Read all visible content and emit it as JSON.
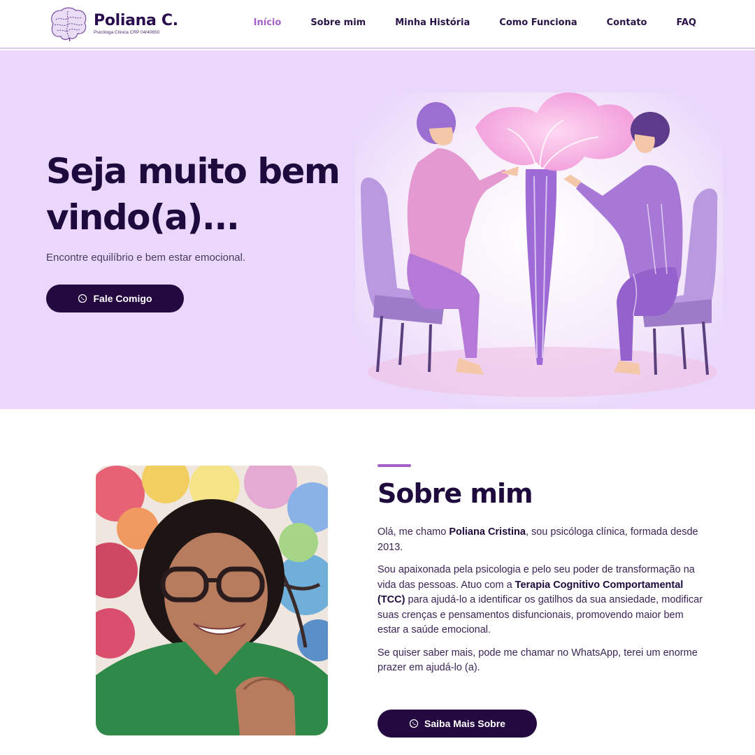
{
  "brand": {
    "name": "Poliana C.",
    "subtitle": "Psicóloga Clínica CRP 04/40650",
    "logo_icon": "brain-icon"
  },
  "nav": {
    "items": [
      {
        "label": "Início",
        "active": true
      },
      {
        "label": "Sobre mim",
        "active": false
      },
      {
        "label": "Minha História",
        "active": false
      },
      {
        "label": "Como Funciona",
        "active": false
      },
      {
        "label": "Contato",
        "active": false
      },
      {
        "label": "FAQ",
        "active": false
      }
    ]
  },
  "hero": {
    "title": "Seja muito bem vindo(a)...",
    "subtitle": "Encontre equilíbrio e bem estar emocional.",
    "cta_label": "Fale Comigo",
    "cta_icon": "whatsapp-icon",
    "illustration": "two-people-seated-conversation-illustration"
  },
  "about": {
    "title": "Sobre mim",
    "p1_a": "Olá, me chamo ",
    "p1_b": "Poliana Cristina",
    "p1_c": ", sou psicóloga clínica, formada desde 2013.",
    "p2_a": "Sou apaixonada pela psicologia e pelo seu poder de transformação na vida das pessoas. Atuo com a ",
    "p2_b": "Terapia Cognitivo Comportamental (TCC)",
    "p2_c": " para ajudá-lo a identificar os gatilhos da sua ansiedade, modificar suas crenças e pensamentos disfuncionais, promovendo maior bem estar a saúde emocional.",
    "p3": "Se quiser saber mais, pode me chamar no WhatsApp, terei um enorme prazer em ajudá-lo (a).",
    "cta_label": "Saiba Mais Sobre",
    "cta_icon": "whatsapp-icon"
  },
  "colors": {
    "hero_bg": "#ead7fb",
    "primary_dark": "#23093f",
    "accent": "#a45fc9"
  }
}
